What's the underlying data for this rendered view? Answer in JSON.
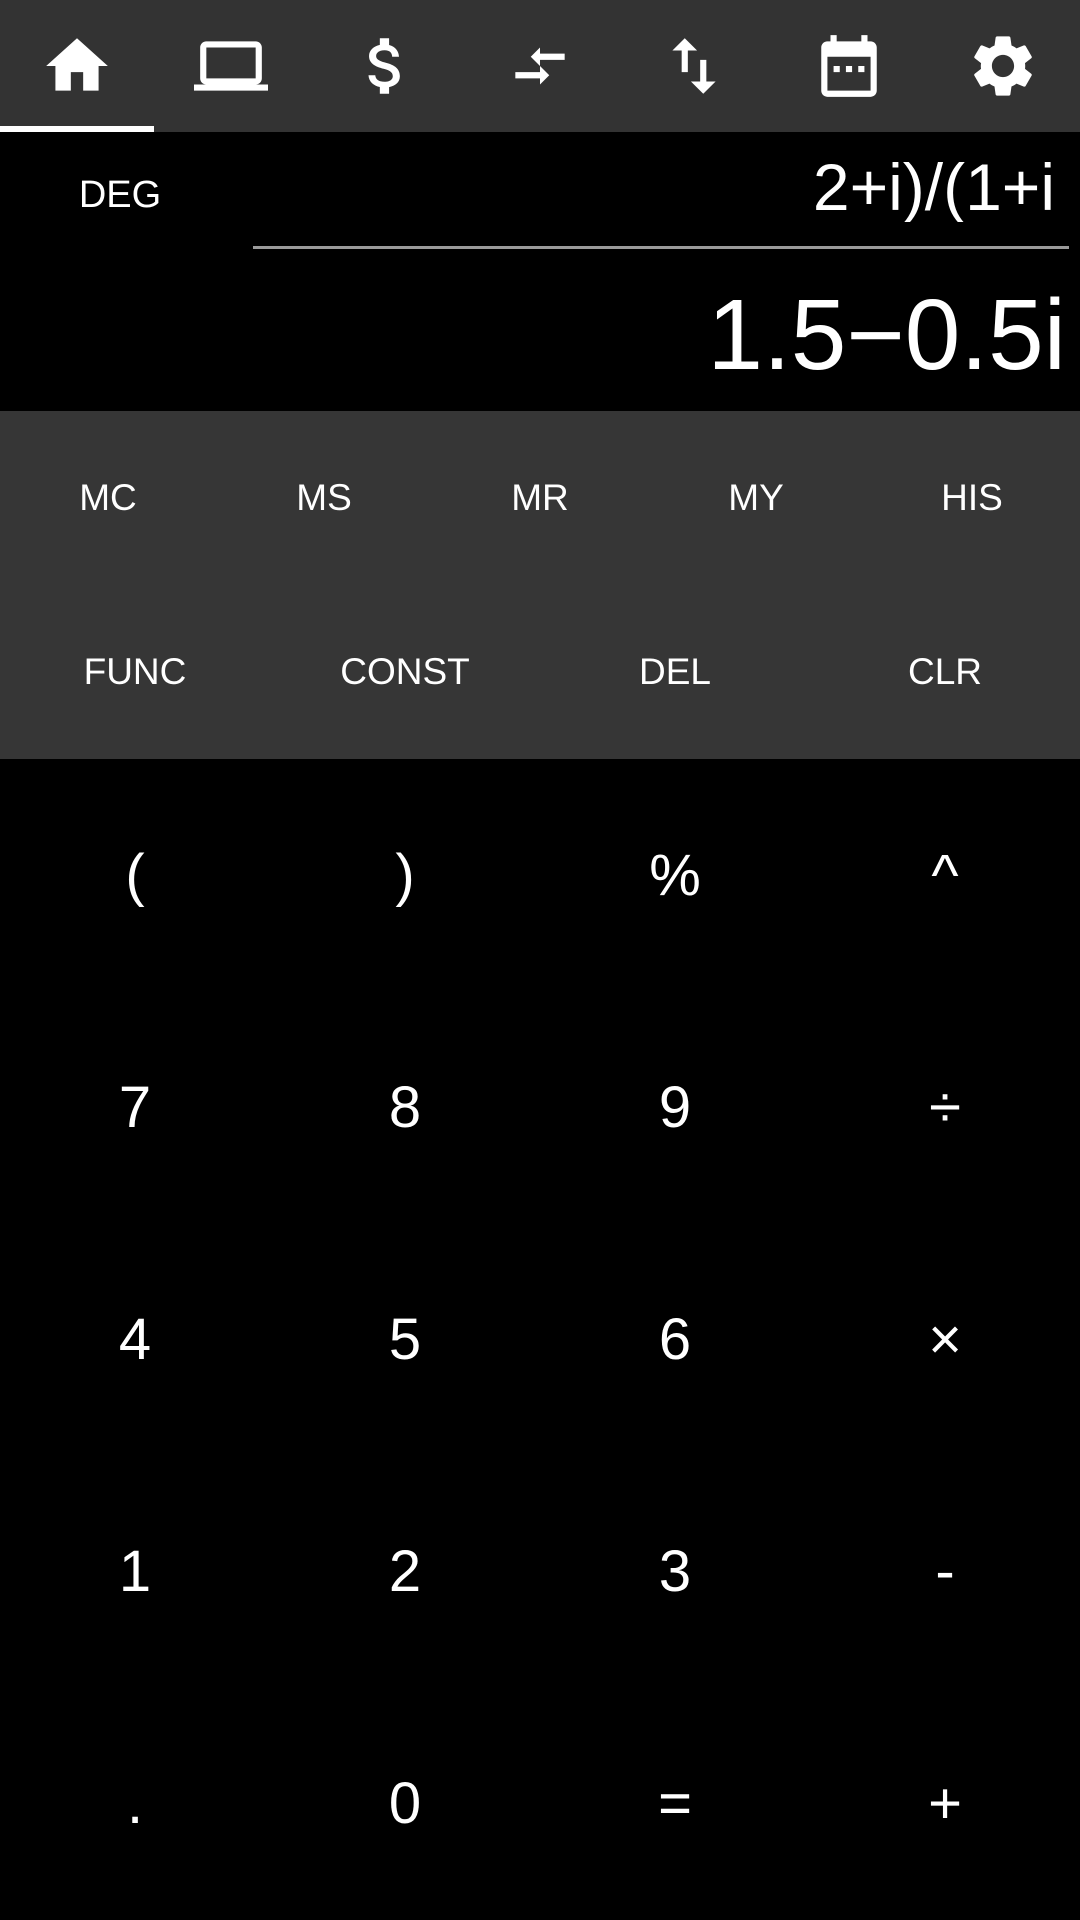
{
  "tabs": [
    {
      "icon": "home-icon",
      "active": true
    },
    {
      "icon": "laptop-icon",
      "active": false
    },
    {
      "icon": "dollar-icon",
      "active": false
    },
    {
      "icon": "arrows-merge-icon",
      "active": false
    },
    {
      "icon": "swap-vertical-icon",
      "active": false
    },
    {
      "icon": "calendar-icon",
      "active": false
    },
    {
      "icon": "settings-gear-icon",
      "active": false
    }
  ],
  "display": {
    "angle_mode": "DEG",
    "expression": "2+i)/(1+i",
    "result": "1.5−0.5i"
  },
  "memory_row": [
    "MC",
    "MS",
    "MR",
    "MY",
    "HIS"
  ],
  "function_row": [
    "FUNC",
    "CONST",
    "DEL",
    "CLR"
  ],
  "keypad": {
    "row1": [
      "(",
      ")",
      "%",
      "^"
    ],
    "row2": [
      "7",
      "8",
      "9",
      "÷"
    ],
    "row3": [
      "4",
      "5",
      "6",
      "×"
    ],
    "row4": [
      "1",
      "2",
      "3",
      "-"
    ],
    "row5": [
      ".",
      "0",
      "=",
      "+"
    ]
  },
  "colors": {
    "tab_bar": "#333333",
    "panel": "#363636",
    "background": "#000000",
    "text": "#ffffff"
  }
}
